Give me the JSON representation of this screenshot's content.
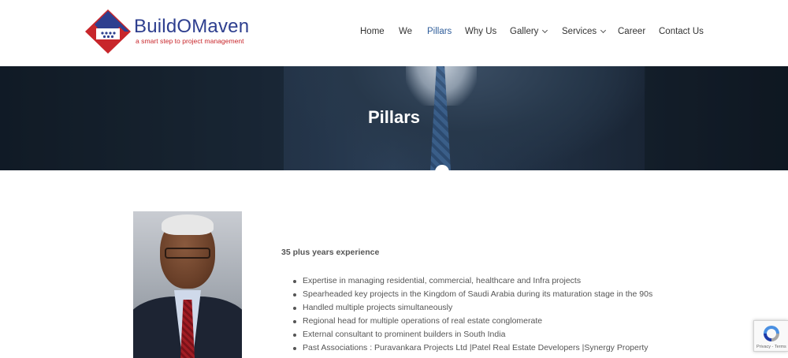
{
  "brand": {
    "name": "BuildOMaven",
    "tagline": "a smart step to project management",
    "colors": {
      "blue": "#2e3f8f",
      "red": "#c8262b"
    }
  },
  "nav": {
    "items": [
      {
        "label": "Home"
      },
      {
        "label": "We"
      },
      {
        "label": "Pillars",
        "active": true
      },
      {
        "label": "Why Us"
      },
      {
        "label": "Gallery",
        "dropdown": true
      },
      {
        "label": "Services",
        "dropdown": true
      },
      {
        "label": "Career"
      },
      {
        "label": "Contact Us"
      }
    ],
    "active_color": "#2f5d9a"
  },
  "banner": {
    "title": "Pillars"
  },
  "profile": {
    "experience": "35 plus years experience",
    "points": [
      "Expertise in managing residential, commercial, healthcare and Infra projects",
      "Spearheaded key projects in the Kingdom of Saudi Arabia during its maturation stage in the 90s",
      "Handled multiple projects simultaneously",
      " Regional head for multiple operations of real estate conglomerate",
      " External consultant to prominent builders in South India",
      "Past Associations : Puravankara Projects Ltd |Patel Real Estate Developers |Synergy Property"
    ]
  },
  "recaptcha": {
    "text": "Privacy - Terms"
  }
}
